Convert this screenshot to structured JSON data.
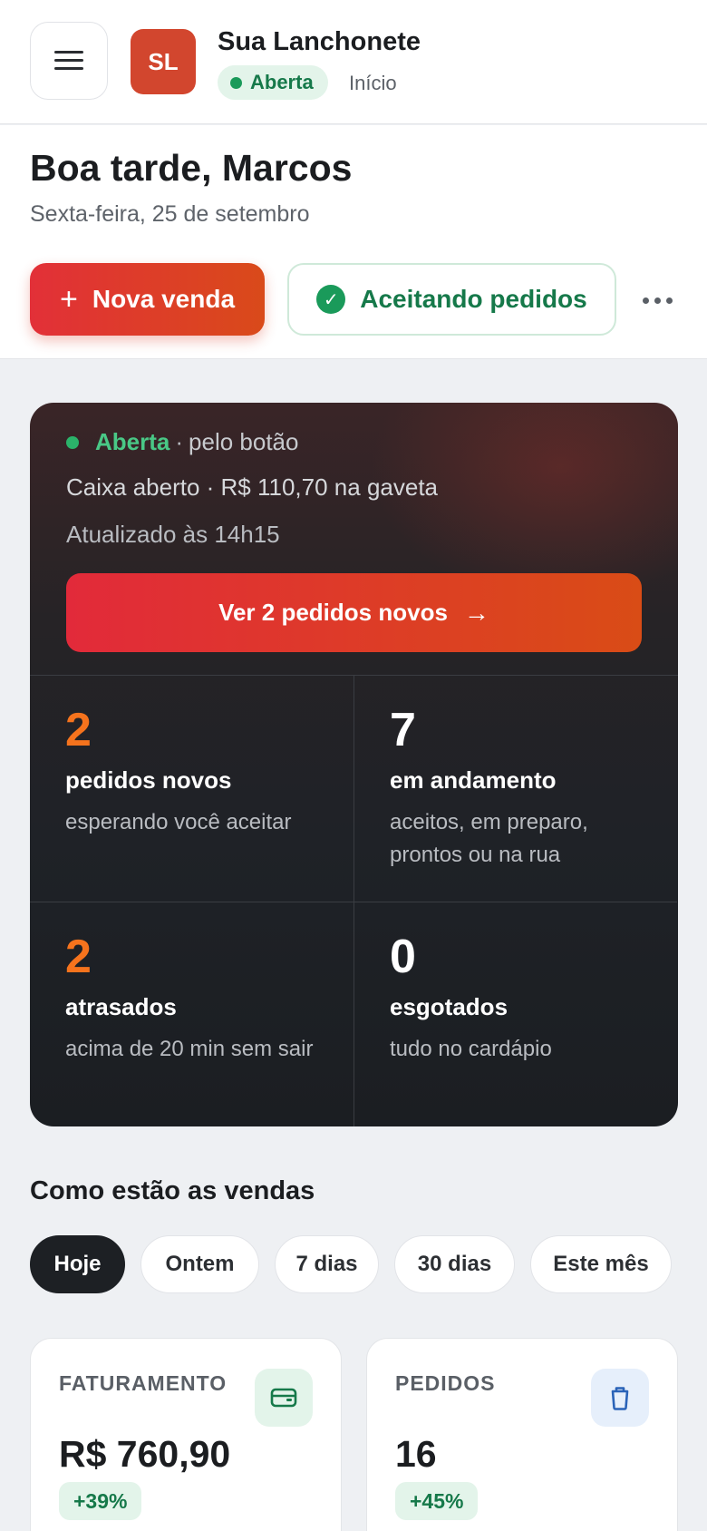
{
  "topbar": {
    "logo_initials": "SL",
    "store_name": "Sua Lanchonete",
    "status": "Aberta",
    "breadcrumb": "Início",
    "menu_icon": "hamburger-icon"
  },
  "header": {
    "greeting": "Boa tarde, Marcos",
    "date": "Sexta-feira, 25 de setembro",
    "new_sale_label": "Nova venda",
    "accepting_label": "Aceitando pedidos",
    "more_icon": "more-horizontal-icon"
  },
  "status_card": {
    "state": "Aberta",
    "separator": "·",
    "mode": "pelo botão",
    "cash": "Caixa aberto · R$ 110,70 na gaveta",
    "updated": "Atualizado às 14h15",
    "cta_label": "Ver 2 pedidos novos",
    "stats": [
      {
        "value": "2",
        "label": "pedidos novos",
        "desc": "esperando você aceitar"
      },
      {
        "value": "7",
        "label": "em andamento",
        "desc": "aceitos, em preparo, prontos ou na rua"
      },
      {
        "value": "2",
        "label": "atrasados",
        "desc": "acima de 20 min sem sair"
      },
      {
        "value": "0",
        "label": "esgotados",
        "desc": "tudo no cardápio"
      }
    ]
  },
  "sales": {
    "title": "Como estão as vendas",
    "periods": [
      "Hoje",
      "Ontem",
      "7 dias",
      "30 dias",
      "Este mês"
    ],
    "active_period": "Hoje",
    "kpis": [
      {
        "label": "FATURAMENTO",
        "value": "R$ 760,90",
        "delta": "+39%",
        "icon": "wallet-icon"
      },
      {
        "label": "PEDIDOS",
        "value": "16",
        "delta": "+45%",
        "icon": "bag-icon"
      }
    ]
  },
  "colors": {
    "brand": "#d2462e",
    "accent_red": "#e23038",
    "success": "#1a9a5a",
    "stat_orange": "#f5731d"
  }
}
